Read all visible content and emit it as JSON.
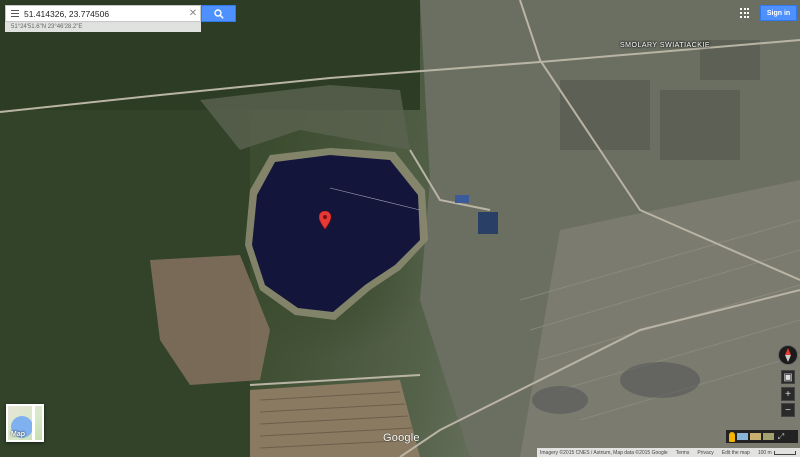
{
  "search": {
    "value": "51.414326, 23.774506",
    "dms": "51°24'51.6\"N 23°46'28.2\"E"
  },
  "header": {
    "signin_label": "Sign in"
  },
  "map": {
    "village_label": "SMOLARY SWIATIACKIE",
    "type_label": "Map",
    "logo": "Google",
    "lake_color": "#13163a",
    "marker_color": "#e53935"
  },
  "footer": {
    "imagery": "Imagery ©2015 CNES / Astrium, Map data ©2015 Google",
    "terms": "Terms",
    "privacy": "Privacy",
    "report": "Edit the map",
    "scale": "100 m"
  },
  "controls": {
    "zoom_in": "+",
    "zoom_out": "−",
    "expand": "⤢"
  },
  "icons": {
    "menu": "menu-icon",
    "clear": "close-icon",
    "search": "search-icon",
    "apps": "apps-icon",
    "compass": "compass-icon",
    "pegman": "pegman-icon",
    "marker": "map-marker-icon"
  }
}
